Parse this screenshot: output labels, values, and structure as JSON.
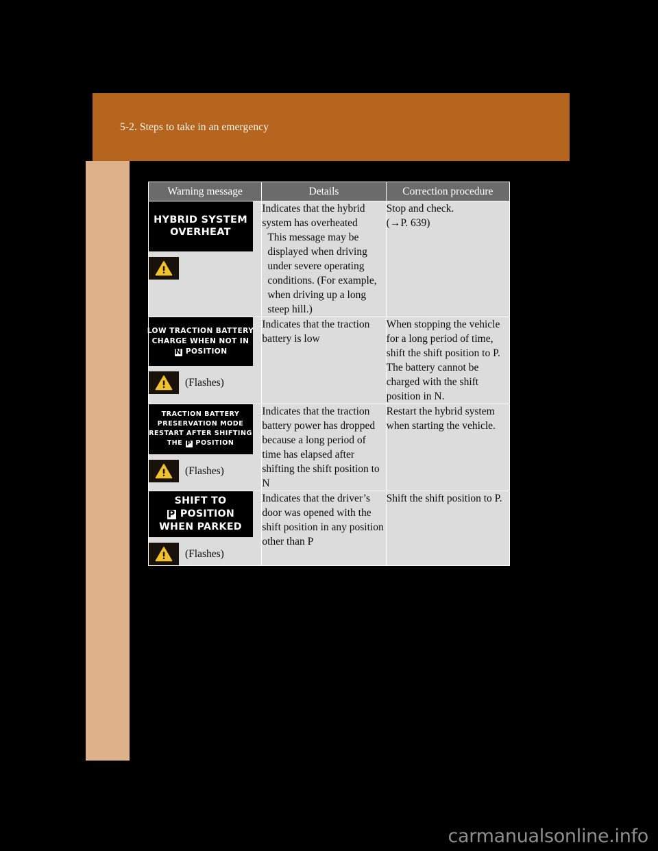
{
  "page": {
    "section_header": "5-2. Steps to take in an emergency",
    "watermark": "carmanualsonline.info",
    "colors": {
      "header_orange": "#b5651d",
      "sidebar_tan": "#ddb189",
      "table_header_gray": "#6b6b6b",
      "table_cell_gray": "#dcdcdc",
      "warning_amber": "#f2c12e",
      "page_background": "#000000"
    }
  },
  "table": {
    "columns": [
      "Warning message",
      "Details",
      "Correction procedure"
    ],
    "rows": [
      {
        "display_lines": [
          "HYBRID SYSTEM",
          "OVERHEAT"
        ],
        "flashes_label": "",
        "details_main": "Indicates that the hybrid system has overheated",
        "details_note": "This message may be displayed when driving under severe operating conditions. (For example, when driving up a long steep hill.)",
        "correction": "Stop and check.",
        "correction_ref": "(→P. 639)"
      },
      {
        "display_lines": [
          "LOW TRACTION BATTERY",
          "CHARGE WHEN NOT IN",
          "N POSITION"
        ],
        "flashes_label": "(Flashes)",
        "details_main": "Indicates that the traction battery is low",
        "details_note": "",
        "correction": "When stopping the vehicle for a long period of time, shift the shift position to P. The battery cannot be charged with the shift position in N.",
        "correction_ref": ""
      },
      {
        "display_lines": [
          "TRACTION BATTERY",
          "PRESERVATION MODE",
          "RESTART AFTER SHIFTING",
          "THE P POSITION"
        ],
        "flashes_label": "(Flashes)",
        "details_main": "Indicates that the traction battery power has dropped because a long period of time has elapsed after shifting the shift position to N",
        "details_note": "",
        "correction": "Restart the hybrid system when starting the vehicle.",
        "correction_ref": ""
      },
      {
        "display_lines": [
          "SHIFT TO",
          "P POSITION",
          "WHEN PARKED"
        ],
        "flashes_label": "(Flashes)",
        "details_main": "Indicates that the driver’s door was opened with the shift position in any position other than P",
        "details_note": "",
        "correction": "Shift the shift position to P.",
        "correction_ref": ""
      }
    ]
  },
  "icons": {
    "warning_triangle": "warning-triangle-icon",
    "arrow_right": "→"
  }
}
